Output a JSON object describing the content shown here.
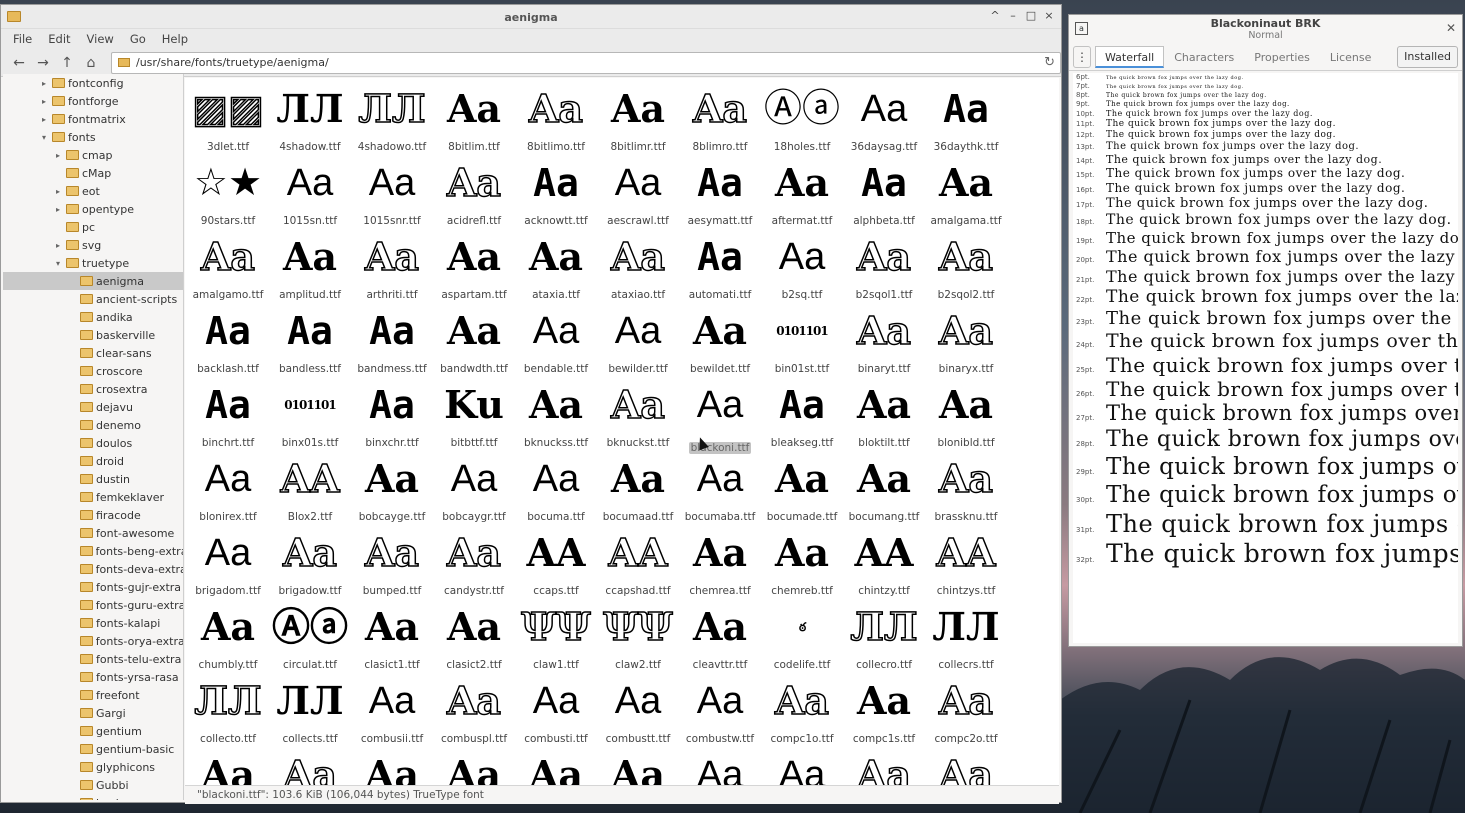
{
  "file_manager": {
    "title": "aenigma",
    "menu": [
      "File",
      "Edit",
      "View",
      "Go",
      "Help"
    ],
    "window_buttons": [
      "^",
      "–",
      "□",
      "×"
    ],
    "location": "/usr/share/fonts/truetype/aenigma/",
    "tree": [
      {
        "label": "fontconfig",
        "depth": 1,
        "expander": "▸"
      },
      {
        "label": "fontforge",
        "depth": 1,
        "expander": "▸"
      },
      {
        "label": "fontmatrix",
        "depth": 1,
        "expander": "▸"
      },
      {
        "label": "fonts",
        "depth": 1,
        "expander": "▾"
      },
      {
        "label": "cmap",
        "depth": 2,
        "expander": "▸"
      },
      {
        "label": "cMap",
        "depth": 2,
        "expander": ""
      },
      {
        "label": "eot",
        "depth": 2,
        "expander": "▸"
      },
      {
        "label": "opentype",
        "depth": 2,
        "expander": "▸"
      },
      {
        "label": "pc",
        "depth": 2,
        "expander": ""
      },
      {
        "label": "svg",
        "depth": 2,
        "expander": "▸"
      },
      {
        "label": "truetype",
        "depth": 2,
        "expander": "▾"
      },
      {
        "label": "aenigma",
        "depth": 3,
        "expander": "",
        "selected": true
      },
      {
        "label": "ancient-scripts",
        "depth": 3,
        "expander": ""
      },
      {
        "label": "andika",
        "depth": 3,
        "expander": ""
      },
      {
        "label": "baskerville",
        "depth": 3,
        "expander": ""
      },
      {
        "label": "clear-sans",
        "depth": 3,
        "expander": ""
      },
      {
        "label": "croscore",
        "depth": 3,
        "expander": ""
      },
      {
        "label": "crosextra",
        "depth": 3,
        "expander": ""
      },
      {
        "label": "dejavu",
        "depth": 3,
        "expander": ""
      },
      {
        "label": "denemo",
        "depth": 3,
        "expander": ""
      },
      {
        "label": "doulos",
        "depth": 3,
        "expander": ""
      },
      {
        "label": "droid",
        "depth": 3,
        "expander": ""
      },
      {
        "label": "dustin",
        "depth": 3,
        "expander": ""
      },
      {
        "label": "femkeklaver",
        "depth": 3,
        "expander": ""
      },
      {
        "label": "firacode",
        "depth": 3,
        "expander": ""
      },
      {
        "label": "font-awesome",
        "depth": 3,
        "expander": ""
      },
      {
        "label": "fonts-beng-extra",
        "depth": 3,
        "expander": ""
      },
      {
        "label": "fonts-deva-extra",
        "depth": 3,
        "expander": ""
      },
      {
        "label": "fonts-gujr-extra",
        "depth": 3,
        "expander": ""
      },
      {
        "label": "fonts-guru-extra",
        "depth": 3,
        "expander": ""
      },
      {
        "label": "fonts-kalapi",
        "depth": 3,
        "expander": ""
      },
      {
        "label": "fonts-orya-extra",
        "depth": 3,
        "expander": ""
      },
      {
        "label": "fonts-telu-extra",
        "depth": 3,
        "expander": ""
      },
      {
        "label": "fonts-yrsa-rasa",
        "depth": 3,
        "expander": ""
      },
      {
        "label": "freefont",
        "depth": 3,
        "expander": ""
      },
      {
        "label": "Gargi",
        "depth": 3,
        "expander": ""
      },
      {
        "label": "gentium",
        "depth": 3,
        "expander": ""
      },
      {
        "label": "gentium-basic",
        "depth": 3,
        "expander": ""
      },
      {
        "label": "glyphicons",
        "depth": 3,
        "expander": ""
      },
      {
        "label": "Gubbi",
        "depth": 3,
        "expander": ""
      },
      {
        "label": "hack",
        "depth": 3,
        "expander": ""
      }
    ],
    "files": [
      {
        "name": "3dlet.ttf",
        "glyph": "▨▨",
        "style": "outline"
      },
      {
        "name": "4shadow.ttf",
        "glyph": "ЛЛ",
        "style": ""
      },
      {
        "name": "4shadowo.ttf",
        "glyph": "ЛЛ",
        "style": "outline"
      },
      {
        "name": "8bitlim.ttf",
        "glyph": "Aa",
        "style": ""
      },
      {
        "name": "8bitlimo.ttf",
        "glyph": "Aa",
        "style": "outline"
      },
      {
        "name": "8bitlimr.ttf",
        "glyph": "Aa",
        "style": ""
      },
      {
        "name": "8blimro.ttf",
        "glyph": "Aa",
        "style": "outline"
      },
      {
        "name": "18holes.ttf",
        "glyph": "Ⓐⓐ",
        "style": "thin"
      },
      {
        "name": "36daysag.ttf",
        "glyph": "Aa",
        "style": "thin"
      },
      {
        "name": "36daythk.ttf",
        "glyph": "Aa",
        "style": "mono"
      },
      {
        "name": "90stars.ttf",
        "glyph": "☆★",
        "style": "thin"
      },
      {
        "name": "1015sn.ttf",
        "glyph": "Aa",
        "style": "thin"
      },
      {
        "name": "1015snr.ttf",
        "glyph": "Aa",
        "style": "thin"
      },
      {
        "name": "acidrefl.ttf",
        "glyph": "Aa",
        "style": "outline"
      },
      {
        "name": "acknowtt.ttf",
        "glyph": "Aa",
        "style": "mono"
      },
      {
        "name": "aescrawl.ttf",
        "glyph": "Aa",
        "style": "thin"
      },
      {
        "name": "aesymatt.ttf",
        "glyph": "Aa",
        "style": "mono"
      },
      {
        "name": "aftermat.ttf",
        "glyph": "Aa",
        "style": ""
      },
      {
        "name": "alphbeta.ttf",
        "glyph": "Aa",
        "style": "mono"
      },
      {
        "name": "amalgama.ttf",
        "glyph": "Aa",
        "style": ""
      },
      {
        "name": "amalgamo.ttf",
        "glyph": "Aa",
        "style": "outline"
      },
      {
        "name": "amplitud.ttf",
        "glyph": "Aa",
        "style": ""
      },
      {
        "name": "arthriti.ttf",
        "glyph": "Aa",
        "style": "outline"
      },
      {
        "name": "aspartam.ttf",
        "glyph": "Aa",
        "style": ""
      },
      {
        "name": "ataxia.ttf",
        "glyph": "Aa",
        "style": ""
      },
      {
        "name": "ataxiao.ttf",
        "glyph": "Aa",
        "style": "outline"
      },
      {
        "name": "automati.ttf",
        "glyph": "Aa",
        "style": "mono"
      },
      {
        "name": "b2sq.ttf",
        "glyph": "Aa",
        "style": "thin"
      },
      {
        "name": "b2sqol1.ttf",
        "glyph": "Aa",
        "style": "outline"
      },
      {
        "name": "b2sqol2.ttf",
        "glyph": "Aa",
        "style": "outline"
      },
      {
        "name": "backlash.ttf",
        "glyph": "Aa",
        "style": "mono"
      },
      {
        "name": "bandless.ttf",
        "glyph": "Aa",
        "style": "mono"
      },
      {
        "name": "bandmess.ttf",
        "glyph": "Aa",
        "style": "mono"
      },
      {
        "name": "bandwdth.ttf",
        "glyph": "Aa",
        "style": ""
      },
      {
        "name": "bendable.ttf",
        "glyph": "Aa",
        "style": "thin"
      },
      {
        "name": "bewilder.ttf",
        "glyph": "Aa",
        "style": "thin"
      },
      {
        "name": "bewildet.ttf",
        "glyph": "Aa",
        "style": ""
      },
      {
        "name": "bin01st.ttf",
        "glyph": "0101101",
        "style": "small"
      },
      {
        "name": "binaryt.ttf",
        "glyph": "Aa",
        "style": "outline"
      },
      {
        "name": "binaryx.ttf",
        "glyph": "Aa",
        "style": "outline"
      },
      {
        "name": "binchrt.ttf",
        "glyph": "Aa",
        "style": "mono"
      },
      {
        "name": "binx01s.ttf",
        "glyph": "0101101",
        "style": "small"
      },
      {
        "name": "binxchr.ttf",
        "glyph": "Aa",
        "style": "mono"
      },
      {
        "name": "bitbttf.ttf",
        "glyph": "Ku",
        "style": ""
      },
      {
        "name": "bknuckss.ttf",
        "glyph": "Aa",
        "style": ""
      },
      {
        "name": "bknuckst.ttf",
        "glyph": "Aa",
        "style": "outline"
      },
      {
        "name": "blackoni.ttf",
        "glyph": "Aa",
        "style": "thin",
        "selected": true
      },
      {
        "name": "bleakseg.ttf",
        "glyph": "Aa",
        "style": "mono"
      },
      {
        "name": "bloktilt.ttf",
        "glyph": "Aa",
        "style": ""
      },
      {
        "name": "blonibld.ttf",
        "glyph": "Aa",
        "style": ""
      },
      {
        "name": "blonirex.ttf",
        "glyph": "Aa",
        "style": "thin"
      },
      {
        "name": "Blox2.ttf",
        "glyph": "AA",
        "style": "outline"
      },
      {
        "name": "bobcayge.ttf",
        "glyph": "Aa",
        "style": ""
      },
      {
        "name": "bobcaygr.ttf",
        "glyph": "Aa",
        "style": "thin"
      },
      {
        "name": "bocuma.ttf",
        "glyph": "Aa",
        "style": "thin"
      },
      {
        "name": "bocumaad.ttf",
        "glyph": "Aa",
        "style": ""
      },
      {
        "name": "bocumaba.ttf",
        "glyph": "Aa",
        "style": "thin"
      },
      {
        "name": "bocumade.ttf",
        "glyph": "Aa",
        "style": ""
      },
      {
        "name": "bocumang.ttf",
        "glyph": "Aa",
        "style": ""
      },
      {
        "name": "brassknu.ttf",
        "glyph": "Aa",
        "style": "outline"
      },
      {
        "name": "brigadom.ttf",
        "glyph": "Aa",
        "style": "thin"
      },
      {
        "name": "brigadow.ttf",
        "glyph": "Aa",
        "style": "outline"
      },
      {
        "name": "bumped.ttf",
        "glyph": "Aa",
        "style": "outline"
      },
      {
        "name": "candystr.ttf",
        "glyph": "Aa",
        "style": "outline"
      },
      {
        "name": "ccaps.ttf",
        "glyph": "AA",
        "style": ""
      },
      {
        "name": "ccapshad.ttf",
        "glyph": "AA",
        "style": "outline"
      },
      {
        "name": "chemrea.ttf",
        "glyph": "Aa",
        "style": ""
      },
      {
        "name": "chemreb.ttf",
        "glyph": "Aa",
        "style": ""
      },
      {
        "name": "chintzy.ttf",
        "glyph": "AA",
        "style": ""
      },
      {
        "name": "chintzys.ttf",
        "glyph": "AA",
        "style": "outline"
      },
      {
        "name": "chumbly.ttf",
        "glyph": "Aa",
        "style": ""
      },
      {
        "name": "circulat.ttf",
        "glyph": "Ⓐⓐ",
        "style": ""
      },
      {
        "name": "clasict1.ttf",
        "glyph": "Aa",
        "style": ""
      },
      {
        "name": "clasict2.ttf",
        "glyph": "Aa",
        "style": ""
      },
      {
        "name": "claw1.ttf",
        "glyph": "ΨΨ",
        "style": "outline"
      },
      {
        "name": "claw2.ttf",
        "glyph": "ΨΨ",
        "style": "outline"
      },
      {
        "name": "cleavttr.ttf",
        "glyph": "Aa",
        "style": ""
      },
      {
        "name": "codelife.ttf",
        "glyph": "ఠ",
        "style": "small"
      },
      {
        "name": "collecro.ttf",
        "glyph": "ЛЛ",
        "style": "outline"
      },
      {
        "name": "collecrs.ttf",
        "glyph": "ЛЛ",
        "style": ""
      },
      {
        "name": "collecto.ttf",
        "glyph": "ЛЛ",
        "style": "outline"
      },
      {
        "name": "collects.ttf",
        "glyph": "ЛЛ",
        "style": ""
      },
      {
        "name": "combusii.ttf",
        "glyph": "Aa",
        "style": "thin"
      },
      {
        "name": "combuspl.ttf",
        "glyph": "Aa",
        "style": "outline"
      },
      {
        "name": "combusti.ttf",
        "glyph": "Aa",
        "style": "thin"
      },
      {
        "name": "combustt.ttf",
        "glyph": "Aa",
        "style": "thin"
      },
      {
        "name": "combustw.ttf",
        "glyph": "Aa",
        "style": "thin"
      },
      {
        "name": "compc1o.ttf",
        "glyph": "Aa",
        "style": "outline"
      },
      {
        "name": "compc1s.ttf",
        "glyph": "Aa",
        "style": ""
      },
      {
        "name": "compc2o.ttf",
        "glyph": "Aa",
        "style": "outline"
      },
      {
        "name": "",
        "glyph": "Aa",
        "style": ""
      },
      {
        "name": "",
        "glyph": "Aa",
        "style": "outline"
      },
      {
        "name": "",
        "glyph": "Aa",
        "style": ""
      },
      {
        "name": "",
        "glyph": "Aa",
        "style": ""
      },
      {
        "name": "",
        "glyph": "Aa",
        "style": ""
      },
      {
        "name": "",
        "glyph": "Aa",
        "style": ""
      },
      {
        "name": "",
        "glyph": "Aa",
        "style": "thin"
      },
      {
        "name": "",
        "glyph": "Aa",
        "style": "thin"
      },
      {
        "name": "",
        "glyph": "Aa",
        "style": "outline"
      },
      {
        "name": "",
        "glyph": "Aa",
        "style": "outline"
      }
    ],
    "status": "\"blackoni.ttf\": 103.6  KiB (106,044 bytes) TrueType font"
  },
  "font_viewer": {
    "title": "Blackoninaut BRK",
    "style": "Normal",
    "menu_icon": "⋮",
    "tabs": [
      "Waterfall",
      "Characters",
      "Properties",
      "License"
    ],
    "active_tab": "Waterfall",
    "installed_label": "Installed",
    "sample": "The quick brown fox jumps over the lazy dog.",
    "sizes": [
      "6pt.",
      "7pt.",
      "8pt.",
      "9pt.",
      "10pt.",
      "11pt.",
      "12pt.",
      "13pt.",
      "14pt.",
      "15pt.",
      "16pt.",
      "17pt.",
      "18pt.",
      "19pt.",
      "20pt.",
      "21pt.",
      "22pt.",
      "23pt.",
      "24pt.",
      "25pt.",
      "26pt.",
      "27pt.",
      "28pt.",
      "29pt.",
      "30pt.",
      "31pt.",
      "32pt."
    ]
  }
}
